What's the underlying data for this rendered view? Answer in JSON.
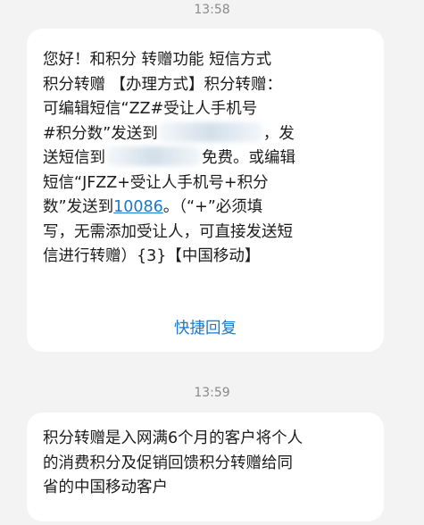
{
  "conversation": {
    "messages": [
      {
        "time": "13:58",
        "lines": [
          "您好！和积分 转赠功能 短信方式",
          "积分转赠 【办理方式】积分转赠：",
          "可编辑短信“ZZ#受让人手机号",
          "#积分数”发送到",
          "，发",
          "送短信到",
          "免费。或编辑",
          "短信“JFZZ+受让人手机号+积分",
          "数”发送到",
          "10086",
          "。（“+”必须填",
          "写，无需添加受让人，可直接发送短",
          "信进行转赠）{3}【中国移动】"
        ],
        "quick_reply": "快捷回复"
      },
      {
        "time": "13:59",
        "lines": [
          "积分转赠是入网满6个月的客户将个人",
          "的消费积分及促销回馈积分转赠给同",
          "省的中国移动客户"
        ]
      }
    ]
  },
  "colors": {
    "background": "#f3f3f3",
    "bubble": "#ffffff",
    "link": "#1a79c8",
    "timestamp": "#8a8a8a"
  }
}
